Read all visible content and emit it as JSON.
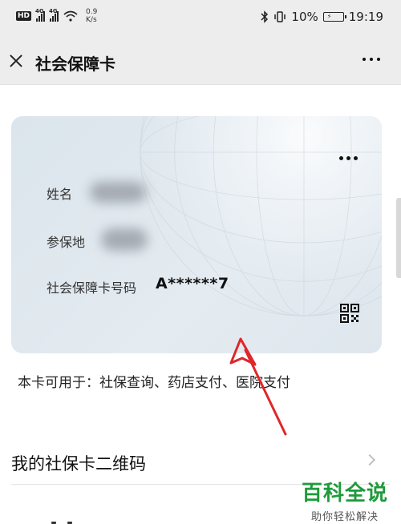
{
  "status_bar": {
    "hd_badge": "HD",
    "sim1_tag": "4G",
    "sim2_tag": "4G",
    "speed_value": "0.9",
    "speed_unit": "K/s",
    "battery_pct": "10%",
    "time": "19:19"
  },
  "title_bar": {
    "title": "社会保障卡"
  },
  "card": {
    "name_label": "姓名",
    "location_label": "参保地",
    "number_label": "社会保障卡号码",
    "number_value": "A******7"
  },
  "usage_text": "本卡可用于：社保查询、药店支付、医院支付",
  "menu": {
    "qrcode_label": "我的社保卡二维码"
  },
  "watermark": {
    "main": "百科全说",
    "sub": "助你轻松解决"
  },
  "colors": {
    "header_bg": "#ededed",
    "card_bg": "#dfe7ee",
    "arrow": "#e0262b",
    "watermark_green": "#1e9b3a"
  }
}
